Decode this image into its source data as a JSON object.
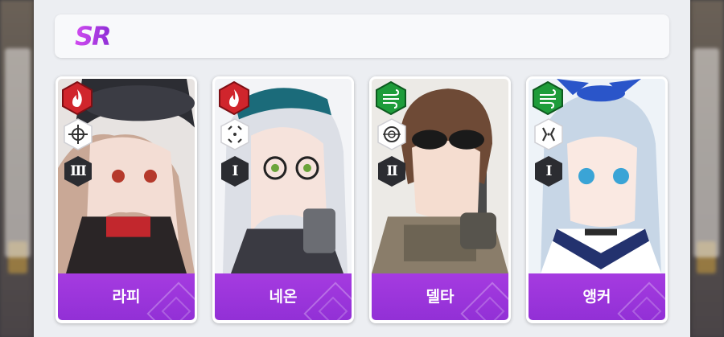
{
  "grade": {
    "label": "SR",
    "colors": [
      "#d24bf0",
      "#8e2ed6"
    ]
  },
  "cards": [
    {
      "name": "라피",
      "element": "fire",
      "element_color": "#d0252c",
      "weapon": "crosshair-icon",
      "burst": "Ⅲ"
    },
    {
      "name": "네온",
      "element": "fire",
      "element_color": "#d0252c",
      "weapon": "reticle-icon",
      "burst": "Ⅰ"
    },
    {
      "name": "델타",
      "element": "wind",
      "element_color": "#1e9c3a",
      "weapon": "scope-icon",
      "burst": "Ⅱ"
    },
    {
      "name": "앵커",
      "element": "wind",
      "element_color": "#1e9c3a",
      "weapon": "bracket-icon",
      "burst": "Ⅰ"
    }
  ],
  "accent": "#9a33d9"
}
